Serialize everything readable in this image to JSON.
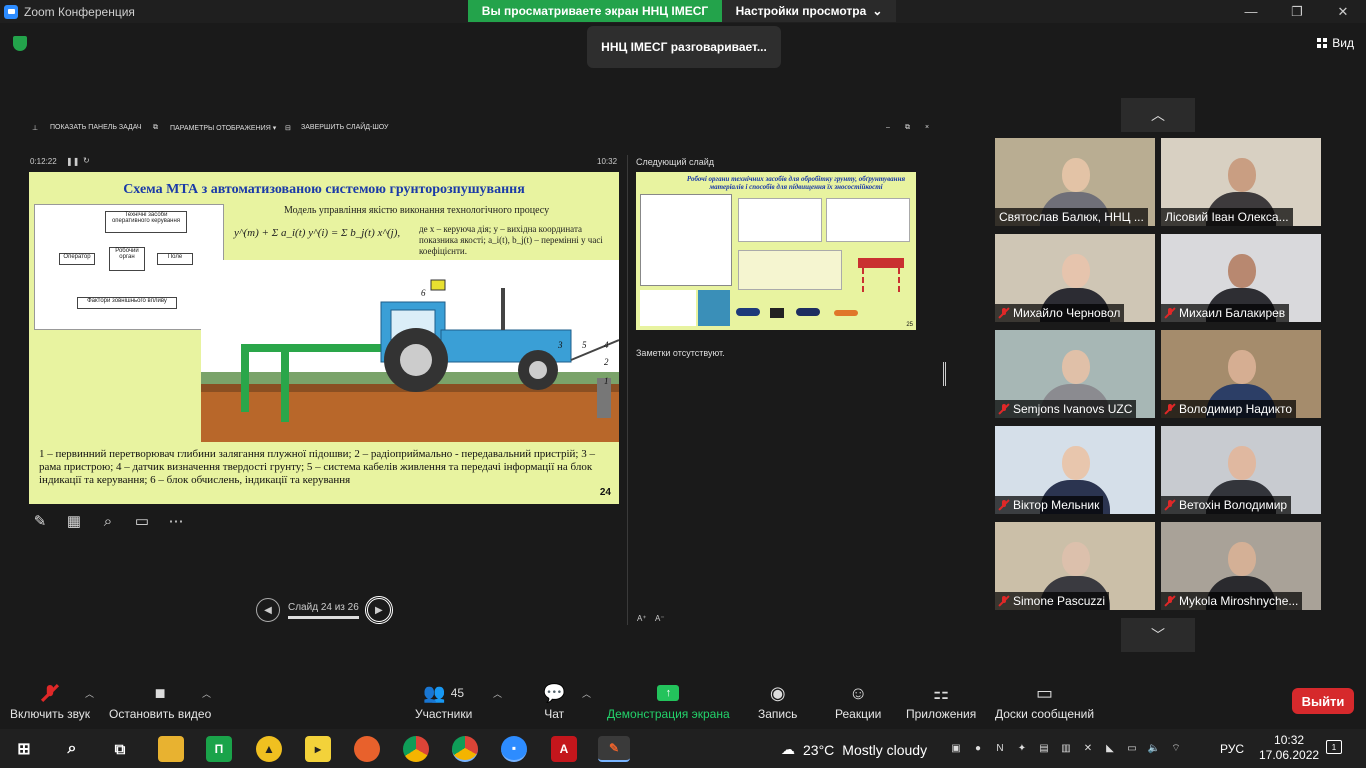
{
  "window": {
    "title": "Zoom Конференция"
  },
  "banner": {
    "sharing_text": "Вы просматриваете экран ННЦ IMECГ",
    "view_options": "Настройки просмотра"
  },
  "talking": "ННЦ IMECГ разговаривает...",
  "view_button": "Вид",
  "presenter": {
    "show_taskbar": "ПОКАЗАТЬ ПАНЕЛЬ ЗАДАЧ",
    "display_settings": "ПАРАМЕТРЫ ОТОБРАЖЕНИЯ ▾",
    "end_show": "ЗАВЕРШИТЬ СЛАЙД-ШОУ",
    "elapsed": "0:12:22",
    "clock": "10:32",
    "next_slide_label": "Следующий слайд",
    "notes": "Заметки отсутствуют.",
    "slide_counter": "Слайд 24 из 26"
  },
  "slide": {
    "title": "Схема МТА з автоматизованою системою грунторозпушування",
    "model_caption": "Модель управління якістю виконання технологічного процесу",
    "formula_text": "y^(m) + Σ a_i(t) y^(i) = Σ b_j(t) x^(j),",
    "formula_description": "де   x – керуюча дія; y – вихідна координата показника якості; a_i(t), b_j(t) – перемінні у часі коефіцієнти.",
    "scheme_labels": {
      "top_box": "Технічні засоби оперативного керування",
      "operator": "Оператор",
      "work_organ": "Робочий орган",
      "field": "Поле",
      "bottom_box": "Фактори зовнішнього впливу"
    },
    "callouts": [
      "1",
      "2",
      "3",
      "4",
      "5",
      "6"
    ],
    "caption": "1 – первинний перетворювач глибини залягання плужної підошви; 2 – радіоприймально - передавальний пристрій; 3 – рама пристрою; 4 – датчик визначення твердості грунту; 5 – система кабелів живлення та передачі інформації на блок індикації та керування; 6 – блок обчислень, індикації та керування",
    "page_number": "24"
  },
  "next_slide": {
    "title": "Робочі органи технічних засобів для обробітку грунту, обґрунтування матеріалів і способів для підвищення їх зносостійкості",
    "page_number": "25"
  },
  "participants": [
    {
      "name": "Святослав Балюк, ННЦ ...",
      "muted": false,
      "bg": "#b9ad92",
      "skin": "#e3c3a6",
      "shirt": "#6f6f78"
    },
    {
      "name": "Лісовий Іван Олекса...",
      "muted": false,
      "bg": "#d8d0c2",
      "skin": "#c99e82",
      "shirt": "#3d3a3c"
    },
    {
      "name": "Михайло Черновол",
      "muted": true,
      "bg": "#cfc6b5",
      "skin": "#e6c4ad",
      "shirt": "#2c2c33"
    },
    {
      "name": "Михаил Балакирев",
      "muted": true,
      "bg": "#d9d9dc",
      "skin": "#b88870",
      "shirt": "#2e2e33"
    },
    {
      "name": "Semjons Ivanovs UZC",
      "muted": true,
      "bg": "#a7b7b5",
      "skin": "#e0c0a8",
      "shirt": "#8b8b90"
    },
    {
      "name": "Володимир Надикто",
      "muted": true,
      "bg": "#a58c6c",
      "skin": "#d6ae92",
      "shirt": "#2c3e66"
    },
    {
      "name": "Віктор Мельник",
      "muted": true,
      "bg": "#d5dfe9",
      "skin": "#e8c6ad",
      "shirt": "#2b3450"
    },
    {
      "name": "Ветохін Володимир",
      "muted": true,
      "bg": "#c8cbd0",
      "skin": "#e0b8a0",
      "shirt": "#33353b"
    },
    {
      "name": "Simone Pascuzzi",
      "muted": true,
      "bg": "#cbbfa8",
      "skin": "#dcc0ac",
      "shirt": "#3a3a40"
    },
    {
      "name": "Mykola Miroshnyche...",
      "muted": true,
      "bg": "#a9a298",
      "skin": "#d4b096",
      "shirt": "#2a2a2e"
    }
  ],
  "toolbar": {
    "mute": "Включить звук",
    "video": "Остановить видео",
    "participants": "Участники",
    "participants_count": "45",
    "chat": "Чат",
    "share": "Демонстрация экрана",
    "record": "Запись",
    "reactions": "Реакции",
    "apps": "Приложения",
    "whiteboards": "Доски сообщений",
    "leave": "Выйти"
  },
  "taskbar": {
    "temperature": "23°C",
    "weather": "Mostly cloudy",
    "language": "РУС",
    "time": "10:32",
    "date": "17.06.2022",
    "notification_count": "1"
  },
  "colors": {
    "accent": "#2d8cff",
    "share_green": "#23a34b",
    "leave_red": "#d6292c",
    "slide_bg": "#e8f3a0",
    "slide_title": "#1a3aa8"
  }
}
